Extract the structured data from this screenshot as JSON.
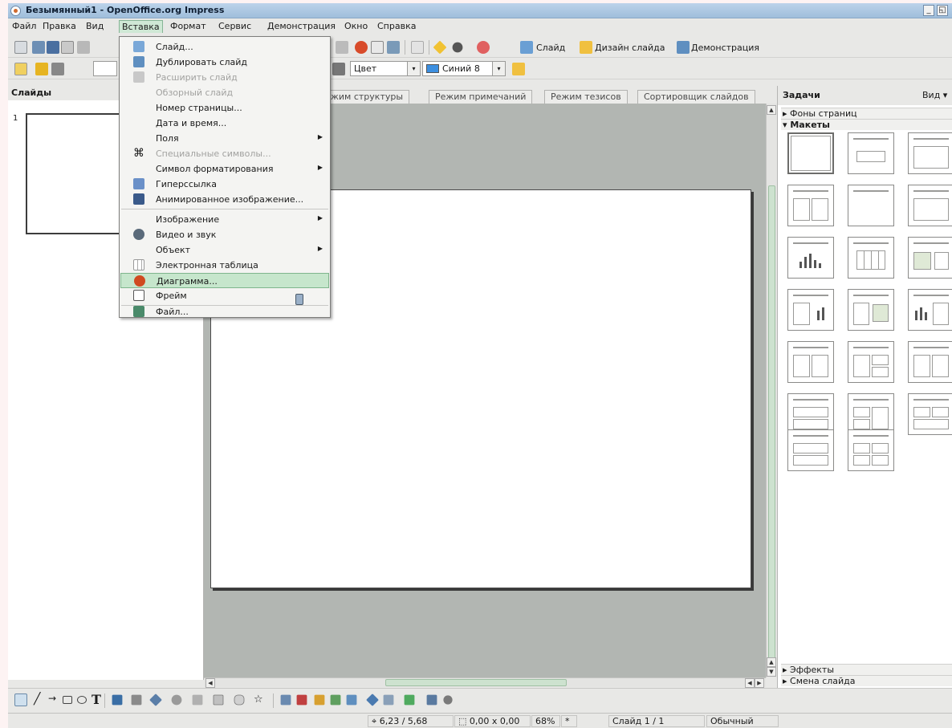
{
  "window": {
    "title": "Безымянный1 - OpenOffice.org Impress",
    "min_btn": "_",
    "restore_btn": "◱"
  },
  "menubar": [
    "Файл",
    "Правка",
    "Вид",
    "Вставка",
    "Формат",
    "Сервис",
    "Демонстрация",
    "Окно",
    "Справка"
  ],
  "toolbar1": {
    "slide": "Слайд",
    "slide_design": "Дизайн слайда",
    "slideshow": "Демонстрация"
  },
  "toolbar2": {
    "color_mode": "Цвет",
    "color_value": "Синий 8"
  },
  "slides_panel": {
    "title": "Слайды",
    "slide_number": "1"
  },
  "view_tabs": [
    "жим структуры",
    "Режим примечаний",
    "Режим тезисов",
    "Сортировщик слайдов"
  ],
  "tasks_panel": {
    "title": "Задачи",
    "view": "Вид",
    "sections": {
      "backgrounds": "Фоны страниц",
      "layouts": "Макеты",
      "effects": "Эффекты",
      "transition": "Смена слайда"
    }
  },
  "insert_menu": {
    "items": [
      {
        "label": "Слайд..."
      },
      {
        "label": "Дублировать слайд"
      },
      {
        "label": "Расширить слайд"
      },
      {
        "label": "Обзорный слайд"
      },
      {
        "label": "Номер страницы..."
      },
      {
        "label": "Дата и время..."
      },
      {
        "label": "Поля"
      },
      {
        "label": "Специальные символы..."
      },
      {
        "label": "Символ форматирования"
      },
      {
        "label": "Гиперссылка"
      },
      {
        "label": "Анимированное изображение..."
      },
      {
        "label": "Изображение"
      },
      {
        "label": "Видео и звук"
      },
      {
        "label": "Объект"
      },
      {
        "label": "Электронная таблица"
      },
      {
        "label": "Диаграмма..."
      },
      {
        "label": "Фрейм"
      },
      {
        "label": "Файл..."
      }
    ]
  },
  "status": {
    "position": "6,23 / 5,68",
    "size": "0,00 x 0,00",
    "zoom": "68%",
    "modified": "*",
    "slide": "Слайд 1 / 1",
    "layout": "Обычный"
  },
  "colors": {
    "highlight": "#c6e6cc",
    "canvas": "#b2b6b2",
    "titlebar": "#a9c5e0"
  }
}
